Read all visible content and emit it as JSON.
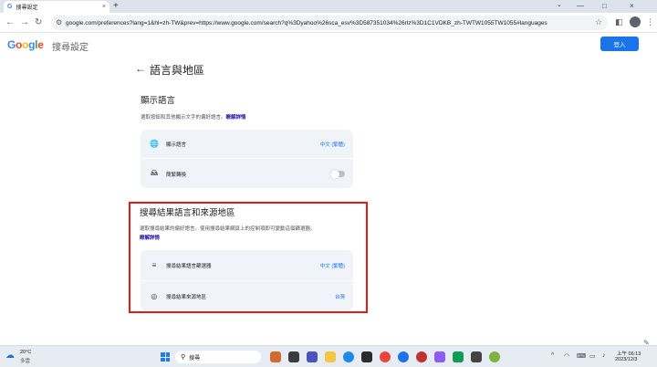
{
  "browser": {
    "tab_title": "搜尋設定",
    "tab_close": "×",
    "new_tab": "+",
    "tab_dropdown": "⌄",
    "window_controls": [
      "—",
      "□",
      "×"
    ],
    "url": "google.com/preferences?lang=1&hl=zh-TW&prev=https://www.google.com/search?q%3Dyahoo%26sca_esv%3D587351034%26rlz%3D1C1VDKB_zh-TWTW1055TW1055#languages"
  },
  "header": {
    "logo_letters": [
      "G",
      "o",
      "o",
      "g",
      "l",
      "e"
    ],
    "subtitle": "搜尋設定",
    "signin_label": "登入"
  },
  "page": {
    "back_icon": "←",
    "title": "語言與地區"
  },
  "display_language": {
    "title": "顯示語言",
    "description": "選取按鈕和其他顯示文字的偏好語言。",
    "learn_more": "瞭解詳情",
    "rows": [
      {
        "label": "顯示語言",
        "value": "中文 (繁體)",
        "icon": "globe-icon"
      },
      {
        "label": "簡繁轉換",
        "value": "",
        "icon": "translate-icon",
        "toggle_on": false
      }
    ]
  },
  "search_results": {
    "title": "搜尋結果語言和來源地區",
    "description": "選取搜尋結果的偏好語言。使用搜尋結果網頁上的控制項即可變動這個篩選器。",
    "learn_more": "瞭解詳情",
    "rows": [
      {
        "label": "搜尋結果語言篩選器",
        "value": "中文 (繁體)",
        "icon": "filter-list-icon"
      },
      {
        "label": "搜尋結果來源地區",
        "value": "台灣",
        "icon": "region-icon"
      }
    ]
  },
  "taskbar": {
    "weather_temp": "20°C",
    "weather_desc": "多雲",
    "search_placeholder": "搜尋",
    "time": "上午 06:13",
    "date": "2023/12/3"
  },
  "colors": {
    "accent": "#1a73e8",
    "highlight_border": "#e31a1a",
    "card_bg": "#f0f4f9"
  }
}
